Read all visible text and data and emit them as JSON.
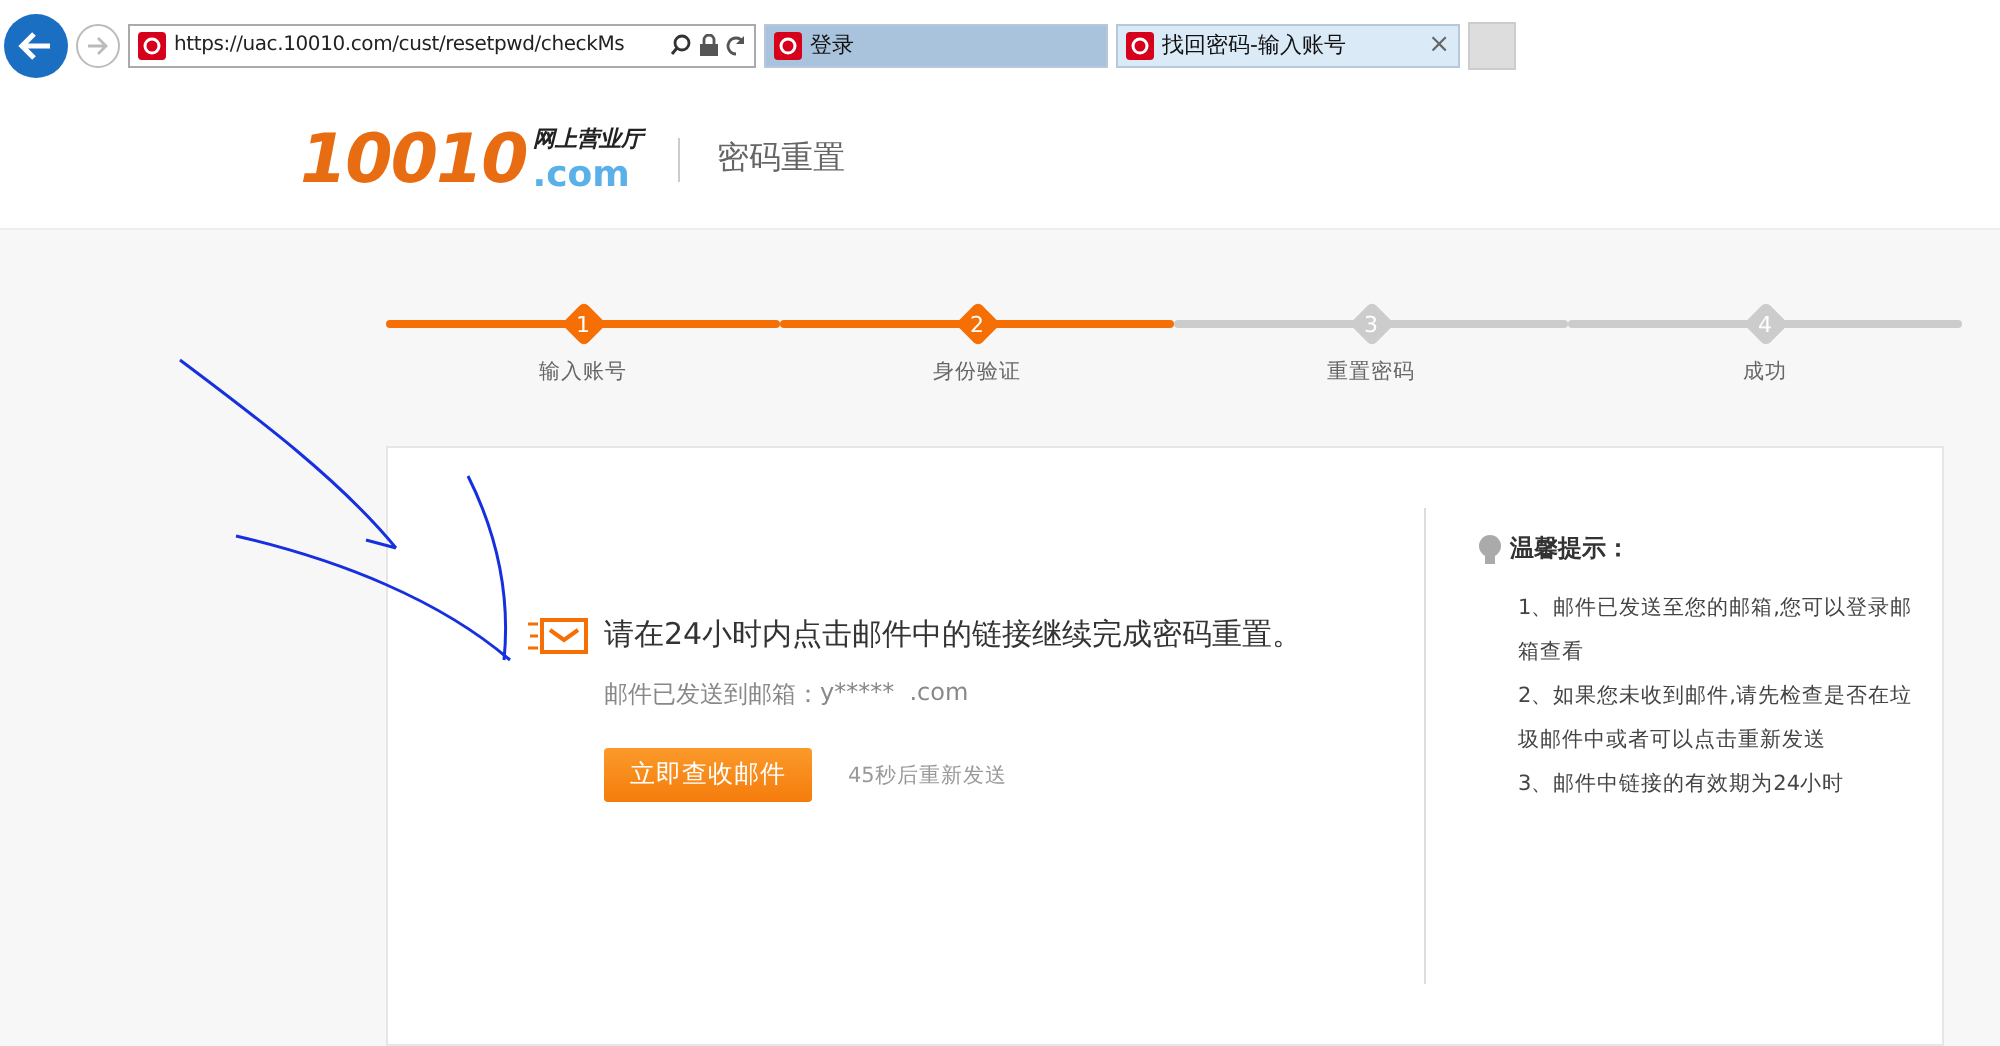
{
  "browser": {
    "url": "https://uac.10010.com/cust/resetpwd/checkMs",
    "tabs": [
      {
        "title": "登录",
        "selected": false
      },
      {
        "title": "找回密码-输入账号",
        "selected": true,
        "close": "×"
      }
    ]
  },
  "header": {
    "logo_number": "10010",
    "logo_tagline": "网上营业厅",
    "logo_domain": ".com",
    "page_title": "密码重置"
  },
  "steps": [
    {
      "number": "1",
      "label": "输入账号",
      "completed": true
    },
    {
      "number": "2",
      "label": "身份验证",
      "completed": true
    },
    {
      "number": "3",
      "label": "重置密码",
      "completed": false
    },
    {
      "number": "4",
      "label": "成功",
      "completed": false
    }
  ],
  "notice": {
    "headline": "请在24小时内点击邮件中的链接继续完成密码重置。",
    "email_label": "邮件已发送到邮箱：",
    "email": "y*****  .com",
    "button": "立即查收邮件",
    "resend": "45秒后重新发送"
  },
  "tips": {
    "title": "温馨提示：",
    "items": [
      "1、邮件已发送至您的邮箱,您可以登录邮箱查看",
      "2、如果您未收到邮件,请先检查是否在垃圾邮件中或者可以点击重新发送",
      "3、邮件中链接的有效期为24小时"
    ]
  }
}
